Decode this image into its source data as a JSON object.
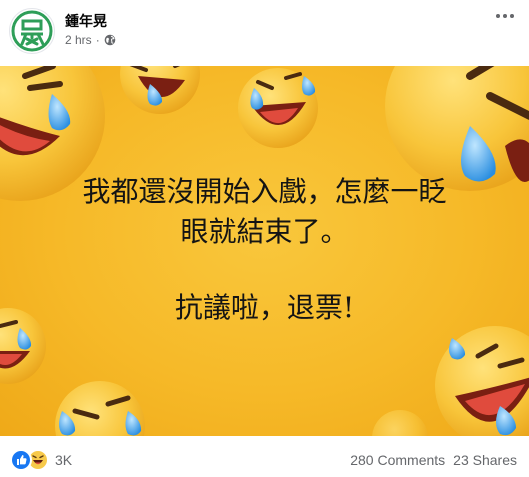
{
  "post": {
    "author": "鍾年晃",
    "timestamp": "2 hrs",
    "separator": "·",
    "privacy_icon": "globe-icon",
    "more_icon": "more-horizontal-icon",
    "avatar_logo": "nianhuang-logo",
    "logo_color": "#2e9e58"
  },
  "image": {
    "background": "#f6b928",
    "line1": "我都還沒開始入戲，怎麼一眨",
    "line2": "眼就結束了。",
    "line3": "抗議啦，退票!"
  },
  "footer": {
    "reaction_icons": [
      "like-icon",
      "haha-icon"
    ],
    "reaction_count": "3K",
    "comments": "280 Comments",
    "shares": "23 Shares"
  }
}
